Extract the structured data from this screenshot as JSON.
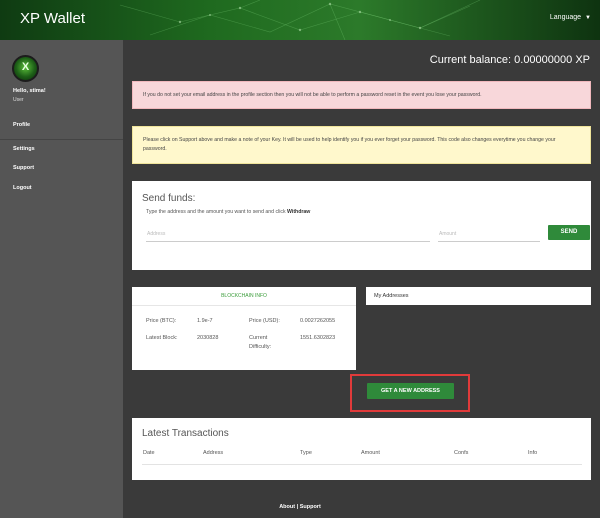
{
  "header": {
    "title": "XP Wallet",
    "language": "Language",
    "language_caret": "▼"
  },
  "sidebar": {
    "avatar_glyph": "X",
    "greeting": "Hello, stima!",
    "role": "User",
    "items": [
      {
        "label": "Profile"
      },
      {
        "label": "Settings"
      },
      {
        "label": "Support"
      },
      {
        "label": "Logout"
      }
    ]
  },
  "balance": "Current balance: 0.00000000 XP",
  "alerts": {
    "email": "If you do not set your email address in the profile section then you will not be able to perform a password reset in the event you lose your password.",
    "key": "Please click on Support above and make a note of your Key. It will be used to help identify you if you ever forget your password. This code also changes everytime you change your password."
  },
  "send": {
    "title": "Send funds:",
    "desc": "Type the address and the amount you want to send and click",
    "desc_bold": "Withdraw",
    "address_placeholder": "Address",
    "amount_placeholder": "Amount",
    "button": "SEND"
  },
  "blockchain": {
    "title": "BLOCKCHAIN INFO",
    "price_btc_label": "Price (BTC):",
    "price_btc": "1.9e-7",
    "price_usd_label": "Price (USD):",
    "price_usd": "0.0027262055",
    "latest_block_label": "Latest Block:",
    "latest_block": "2030828",
    "difficulty_label_1": "Current",
    "difficulty_label_2": "Difficulty:",
    "difficulty": "1551.6302823"
  },
  "addresses": {
    "title": "My Addresses",
    "new_button": "GET A NEW ADDRESS"
  },
  "transactions": {
    "title": "Latest Transactions",
    "columns": [
      "Date",
      "Address",
      "Type",
      "Amount",
      "Confs",
      "Info"
    ]
  },
  "footer": {
    "about": "About",
    "sep": " | ",
    "support": "Support"
  },
  "colors": {
    "accent_green": "#2f8a3a",
    "highlight_red": "#e03a3a"
  }
}
